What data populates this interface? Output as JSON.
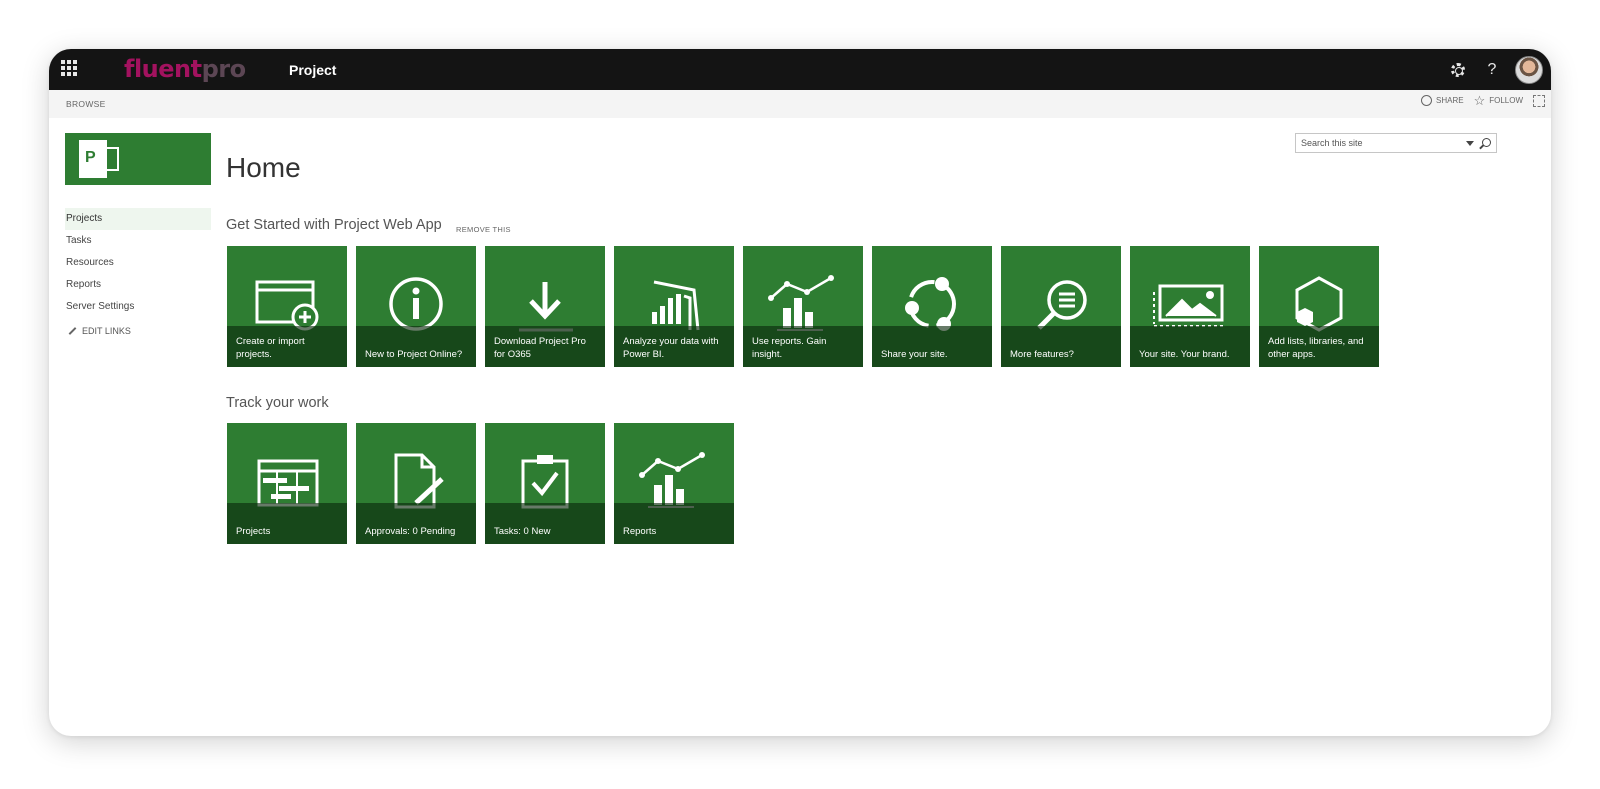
{
  "suitebar": {
    "logo_part1": "fluent",
    "logo_part2": "pro",
    "app_title": "Project"
  },
  "ribbon": {
    "browse": "BROWSE",
    "share": "SHARE",
    "follow": "FOLLOW"
  },
  "leftnav": {
    "items": [
      "Projects",
      "Tasks",
      "Resources",
      "Reports",
      "Server Settings"
    ],
    "selected": "Projects",
    "edit_links": "EDIT LINKS"
  },
  "search": {
    "placeholder": "Search this site"
  },
  "main": {
    "title": "Home",
    "get_started": {
      "title": "Get Started with Project Web App",
      "remove_label": "REMOVE THIS",
      "tiles": [
        {
          "label": "Create or import projects.",
          "icon": "add-window-icon"
        },
        {
          "label": "New to Project Online?",
          "icon": "info-icon"
        },
        {
          "label": "Download Project Pro for O365",
          "icon": "download-icon"
        },
        {
          "label": "Analyze your data with Power BI.",
          "icon": "power-bi-icon"
        },
        {
          "label": "Use reports. Gain insight.",
          "icon": "report-chart-icon"
        },
        {
          "label": "Share your site.",
          "icon": "share-icon"
        },
        {
          "label": "More features?",
          "icon": "search-features-icon"
        },
        {
          "label": "Your site. Your brand.",
          "icon": "brand-image-icon"
        },
        {
          "label": "Add lists, libraries, and other apps.",
          "icon": "apps-hexagon-icon"
        }
      ]
    },
    "track_work": {
      "title": "Track your work",
      "tiles": [
        {
          "label": "Projects",
          "icon": "gantt-icon"
        },
        {
          "label": "Approvals: 0 Pending",
          "icon": "approval-document-icon"
        },
        {
          "label": "Tasks: 0 New",
          "icon": "task-clipboard-icon"
        },
        {
          "label": "Reports",
          "icon": "report-chart-icon"
        }
      ]
    }
  },
  "colors": {
    "tile_green": "#2e7d32",
    "suitebar": "#141414",
    "brand_magenta": "#a3125f"
  }
}
